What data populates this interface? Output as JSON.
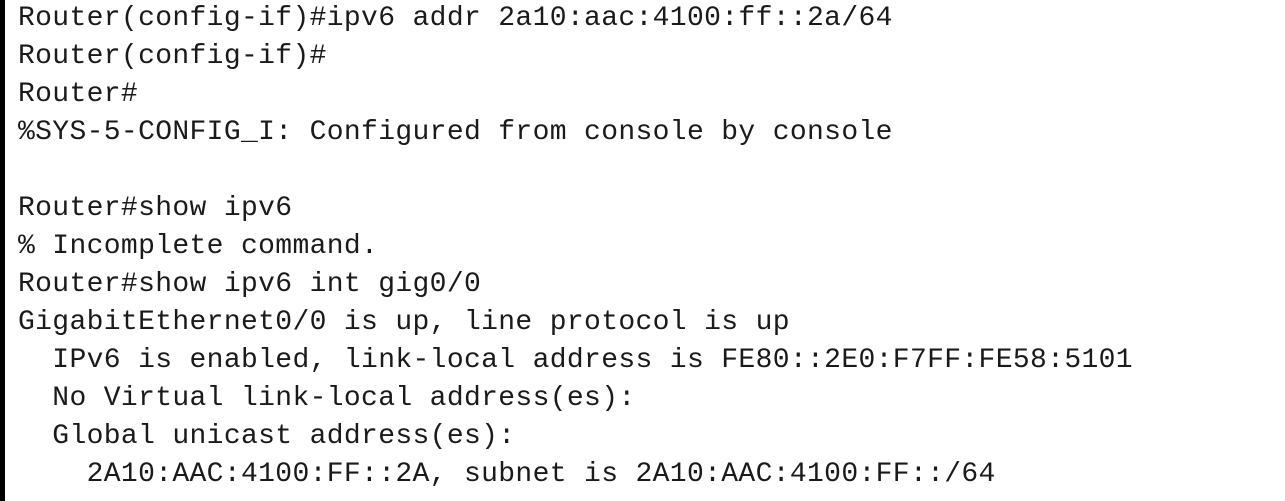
{
  "terminal": {
    "lines": [
      "Router(config-if)#ipv6 addr 2a10:aac:4100:ff::2a/64",
      "Router(config-if)#",
      "Router#",
      "%SYS-5-CONFIG_I: Configured from console by console",
      "",
      "Router#show ipv6",
      "% Incomplete command.",
      "Router#show ipv6 int gig0/0",
      "GigabitEthernet0/0 is up, line protocol is up",
      "  IPv6 is enabled, link-local address is FE80::2E0:F7FF:FE58:5101",
      "  No Virtual link-local address(es):",
      "  Global unicast address(es):",
      "    2A10:AAC:4100:FF::2A, subnet is 2A10:AAC:4100:FF::/64"
    ]
  }
}
